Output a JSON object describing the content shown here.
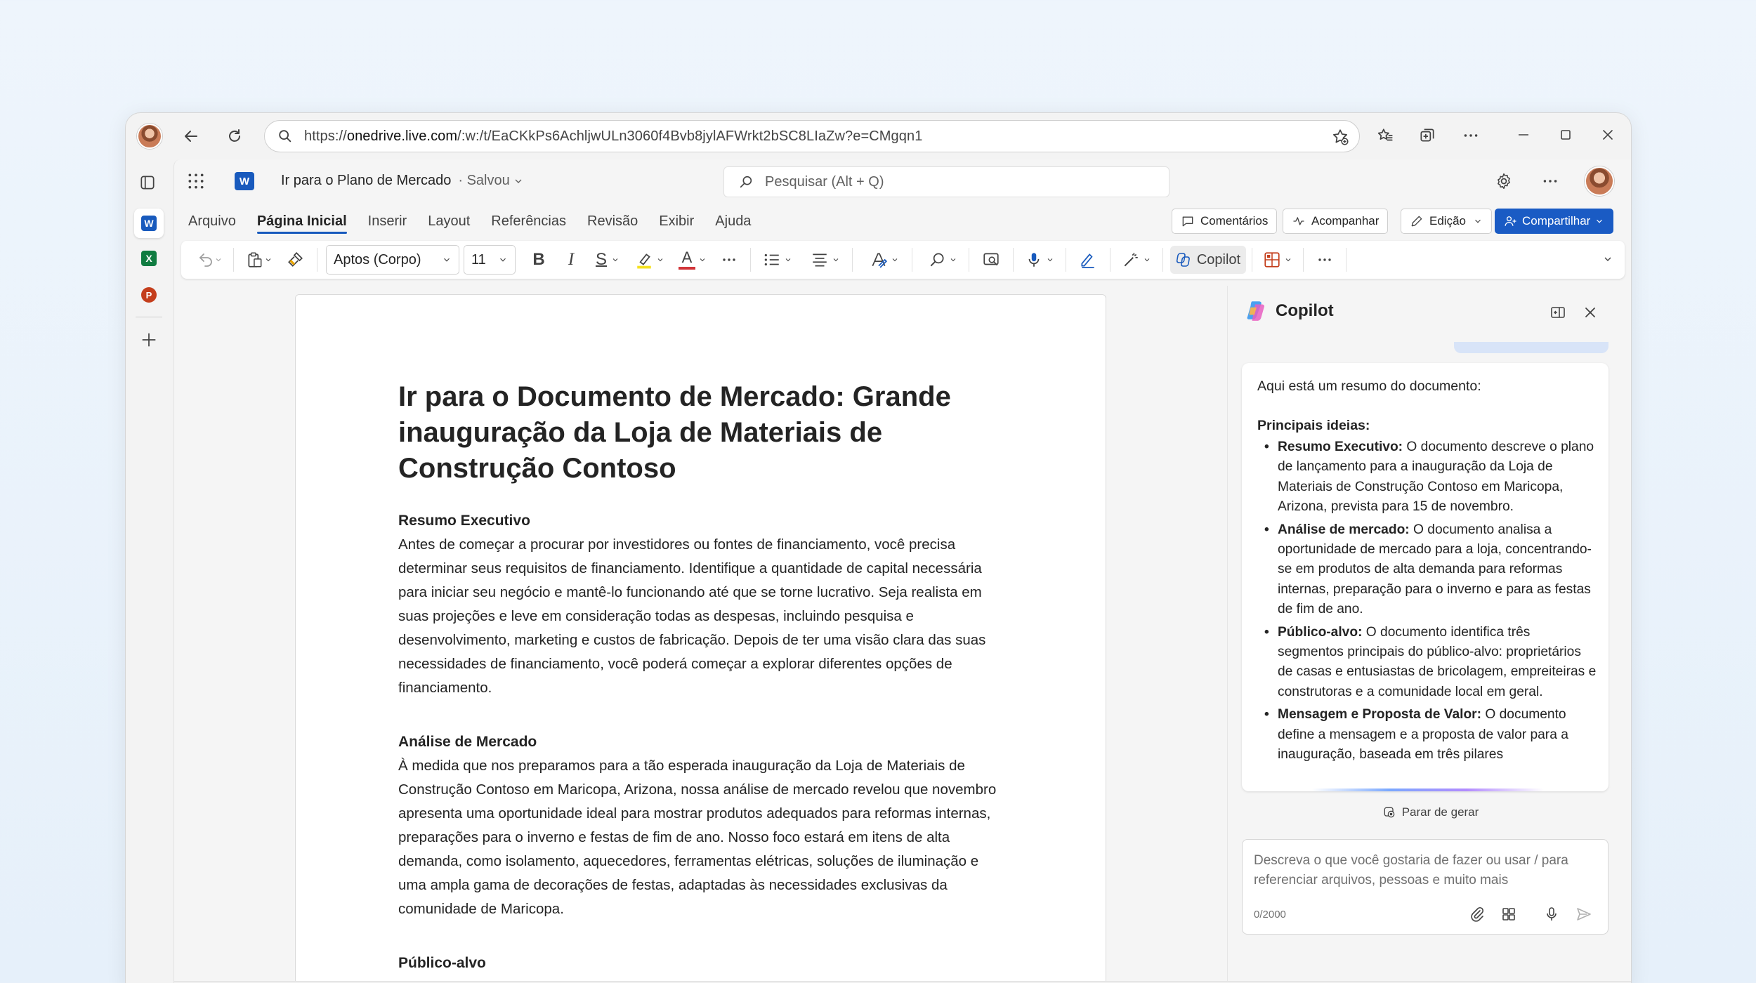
{
  "browser": {
    "url_prefix": "https://",
    "url_host": "onedrive.live.com",
    "url_path": "/:w:/t/EaCKkPs6AchljwULn3060f4Bvb8jylAFWrkt2bSC8LIaZw?e=CMgqn1"
  },
  "word": {
    "doc_title": "Ir para o Plano de Mercado",
    "save_status": "· Salvou",
    "search_placeholder": "Pesquisar (Alt + Q)",
    "tabs": [
      "Arquivo",
      "Página Inicial",
      "Inserir",
      "Layout",
      "Referências",
      "Revisão",
      "Exibir",
      "Ajuda"
    ],
    "buttons": {
      "comments": "Comentários",
      "follow": "Acompanhar",
      "editing": "Edição",
      "share": "Compartilhar"
    },
    "toolbar": {
      "font": "Aptos (Corpo)",
      "size": "11",
      "bold": "B",
      "italic": "I",
      "strike": "S",
      "font_color": "A",
      "copilot": "Copilot"
    }
  },
  "document": {
    "title": "Ir para o Documento de Mercado: Grande inauguração da Loja de Materiais de Construção Contoso",
    "sections": [
      {
        "heading": "Resumo Executivo",
        "body": "Antes de começar a procurar por investidores ou fontes de financiamento, você precisa determinar seus requisitos de financiamento. Identifique a quantidade de capital necessária para iniciar seu negócio e mantê-lo funcionando até que se torne lucrativo. Seja realista em suas projeções e leve em consideração todas as despesas, incluindo pesquisa e desenvolvimento, marketing e custos de fabricação. Depois de ter uma visão clara das suas necessidades de financiamento, você poderá começar a explorar diferentes opções de financiamento."
      },
      {
        "heading": "Análise de Mercado",
        "body": "À medida que nos preparamos para a tão esperada inauguração da Loja de Materiais de Construção Contoso em Maricopa, Arizona, nossa análise de mercado revelou que novembro apresenta uma oportunidade ideal para mostrar produtos adequados para reformas internas, preparações para o inverno e festas de fim de ano. Nosso foco estará em itens de alta demanda, como isolamento, aquecedores, ferramentas elétricas, soluções de iluminação e uma ampla gama de decorações de festas, adaptadas às necessidades exclusivas da comunidade de Maricopa."
      },
      {
        "heading": "Público-alvo",
        "body": ""
      }
    ]
  },
  "copilot": {
    "title": "Copilot",
    "intro": "Aqui está um resumo do documento:",
    "points_heading": "Principais ideias:",
    "points": [
      {
        "label": "Resumo Executivo:",
        "text": " O documento descreve o plano de lançamento para a inauguração da Loja de Materiais de Construção Contoso em Maricopa, Arizona, prevista para 15 de novembro."
      },
      {
        "label": "Análise de mercado:",
        "text": " O documento analisa a oportunidade de mercado para a loja, concentrando-se em produtos de alta demanda para reformas internas, preparação para o inverno e para as festas de fim de ano."
      },
      {
        "label": "Público-alvo:",
        "text": " O documento identifica três segmentos principais do público-alvo: proprietários de casas e entusiastas de bricolagem, empreiteiras e construtoras e a comunidade local em geral."
      },
      {
        "label": "Mensagem e Proposta de Valor:",
        "text": " O documento define a mensagem e a proposta de valor para a inauguração, baseada em três pilares"
      }
    ],
    "stop_label": "Parar de gerar",
    "input_placeholder": "Descreva o que você gostaria de fazer ou usar / para referenciar arquivos, pessoas e muito mais",
    "char_count": "0/2000"
  },
  "colors": {
    "accent": "#185abd",
    "share_bg": "#1a5bc4",
    "word_blue": "#185abd",
    "excel_green": "#107c41",
    "ppt_orange": "#c43e1c"
  }
}
